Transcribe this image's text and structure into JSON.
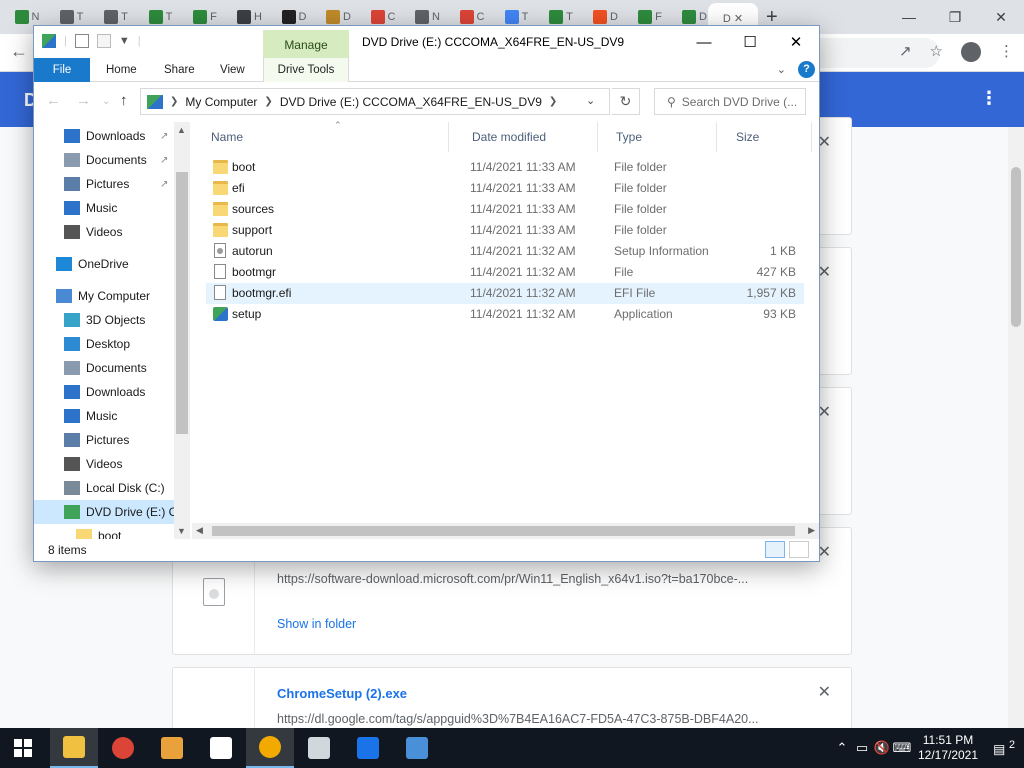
{
  "chrome": {
    "tabs": [
      {
        "letter": "N",
        "color": "#2e8b3d"
      },
      {
        "letter": "T",
        "color": "#5f6368"
      },
      {
        "letter": "T",
        "color": "#5f6368"
      },
      {
        "letter": "T",
        "color": "#2e8b3d"
      },
      {
        "letter": "F",
        "color": "#2e8b3d"
      },
      {
        "letter": "H",
        "color": "#3c4043"
      },
      {
        "letter": "D",
        "color": "#222222"
      },
      {
        "letter": "D",
        "color": "#c08a2a"
      },
      {
        "letter": "C",
        "color": "#db4437"
      },
      {
        "letter": "N",
        "color": "#5f6368"
      },
      {
        "letter": "C",
        "color": "#db4437"
      },
      {
        "letter": "T",
        "color": "#4285f4"
      },
      {
        "letter": "T",
        "color": "#2e8b3d"
      },
      {
        "letter": "D",
        "color": "#f25022"
      },
      {
        "letter": "F",
        "color": "#2e8b3d"
      },
      {
        "letter": "D",
        "color": "#2e8b3d"
      }
    ],
    "new_tab": "+",
    "downloads_title": "D",
    "menu_icon": "⋮",
    "downloads": [
      {
        "url": "https://software-download.microsoft.com/pr/Win11_English_x64v1.iso?t=ba170bce-...",
        "action": "Show in folder"
      },
      {
        "name": "ChromeSetup (2).exe",
        "url": "https://dl.google.com/tag/s/appguid%3D%7B4EA16AC7-FD5A-47C3-875B-DBF4A20..."
      }
    ]
  },
  "explorer": {
    "title": "DVD Drive (E:) CCCOMA_X64FRE_EN-US_DV9",
    "ribbon": {
      "manage": "Manage",
      "tabs": [
        "File",
        "Home",
        "Share",
        "View"
      ],
      "drive_tools": "Drive Tools"
    },
    "address": {
      "root": "My Computer",
      "current": "DVD Drive (E:) CCCOMA_X64FRE_EN-US_DV9"
    },
    "search_placeholder": "Search DVD Drive (...",
    "nav_items": [
      {
        "label": "Downloads",
        "icon": "download-icon",
        "pinned": true
      },
      {
        "label": "Documents",
        "icon": "documents-icon",
        "pinned": true
      },
      {
        "label": "Pictures",
        "icon": "pictures-icon",
        "pinned": true
      },
      {
        "label": "Music",
        "icon": "music-icon",
        "pinned": false
      },
      {
        "label": "Videos",
        "icon": "videos-icon",
        "pinned": false
      },
      {
        "label": "OneDrive",
        "icon": "onedrive-icon",
        "pinned": false
      },
      {
        "label": "My Computer",
        "icon": "computer-icon",
        "pinned": false
      },
      {
        "label": "3D Objects",
        "icon": "3d-objects-icon",
        "pinned": false
      },
      {
        "label": "Desktop",
        "icon": "desktop-icon",
        "pinned": false
      },
      {
        "label": "Documents",
        "icon": "documents-icon",
        "pinned": false
      },
      {
        "label": "Downloads",
        "icon": "download-icon",
        "pinned": false
      },
      {
        "label": "Music",
        "icon": "music-icon",
        "pinned": false
      },
      {
        "label": "Pictures",
        "icon": "pictures-icon",
        "pinned": false
      },
      {
        "label": "Videos",
        "icon": "videos-icon",
        "pinned": false
      },
      {
        "label": "Local Disk (C:)",
        "icon": "local-disk-icon",
        "pinned": false
      },
      {
        "label": "DVD Drive (E:) CC",
        "icon": "dvd-drive-icon",
        "pinned": false,
        "selected": true
      },
      {
        "label": "boot",
        "icon": "folder-icon",
        "pinned": false
      }
    ],
    "columns": [
      "Name",
      "Date modified",
      "Type",
      "Size"
    ],
    "files": [
      {
        "name": "boot",
        "date": "11/4/2021 11:33 AM",
        "type": "File folder",
        "size": "",
        "icon": "folder"
      },
      {
        "name": "efi",
        "date": "11/4/2021 11:33 AM",
        "type": "File folder",
        "size": "",
        "icon": "folder"
      },
      {
        "name": "sources",
        "date": "11/4/2021 11:33 AM",
        "type": "File folder",
        "size": "",
        "icon": "folder"
      },
      {
        "name": "support",
        "date": "11/4/2021 11:33 AM",
        "type": "File folder",
        "size": "",
        "icon": "folder"
      },
      {
        "name": "autorun",
        "date": "11/4/2021 11:32 AM",
        "type": "Setup Information",
        "size": "1 KB",
        "icon": "inf"
      },
      {
        "name": "bootmgr",
        "date": "11/4/2021 11:32 AM",
        "type": "File",
        "size": "427 KB",
        "icon": "doc"
      },
      {
        "name": "bootmgr.efi",
        "date": "11/4/2021 11:32 AM",
        "type": "EFI File",
        "size": "1,957 KB",
        "icon": "doc",
        "hover": true
      },
      {
        "name": "setup",
        "date": "11/4/2021 11:32 AM",
        "type": "Application",
        "size": "93 KB",
        "icon": "app"
      }
    ],
    "status": "8 items"
  },
  "taskbar": {
    "time": "11:51 PM",
    "date": "12/17/2021",
    "notifications": "2",
    "apps": [
      {
        "name": "file-explorer",
        "color": "#f0c040",
        "active": true
      },
      {
        "name": "chrome",
        "color": "#db4437"
      },
      {
        "name": "photos",
        "color": "#e9a23b"
      },
      {
        "name": "settings",
        "color": "#ffffff"
      },
      {
        "name": "chrome-canary",
        "color": "#f2a900",
        "active": true
      },
      {
        "name": "app",
        "color": "#cfd8dc"
      },
      {
        "name": "malwarebytes",
        "color": "#1a73e8"
      },
      {
        "name": "setup-app",
        "color": "#4a90d9"
      }
    ]
  },
  "colors": {
    "accent": "#1979ca",
    "manage": "#d6ecc0",
    "chrome_header": "#3367d6",
    "link": "#1a73e8"
  }
}
